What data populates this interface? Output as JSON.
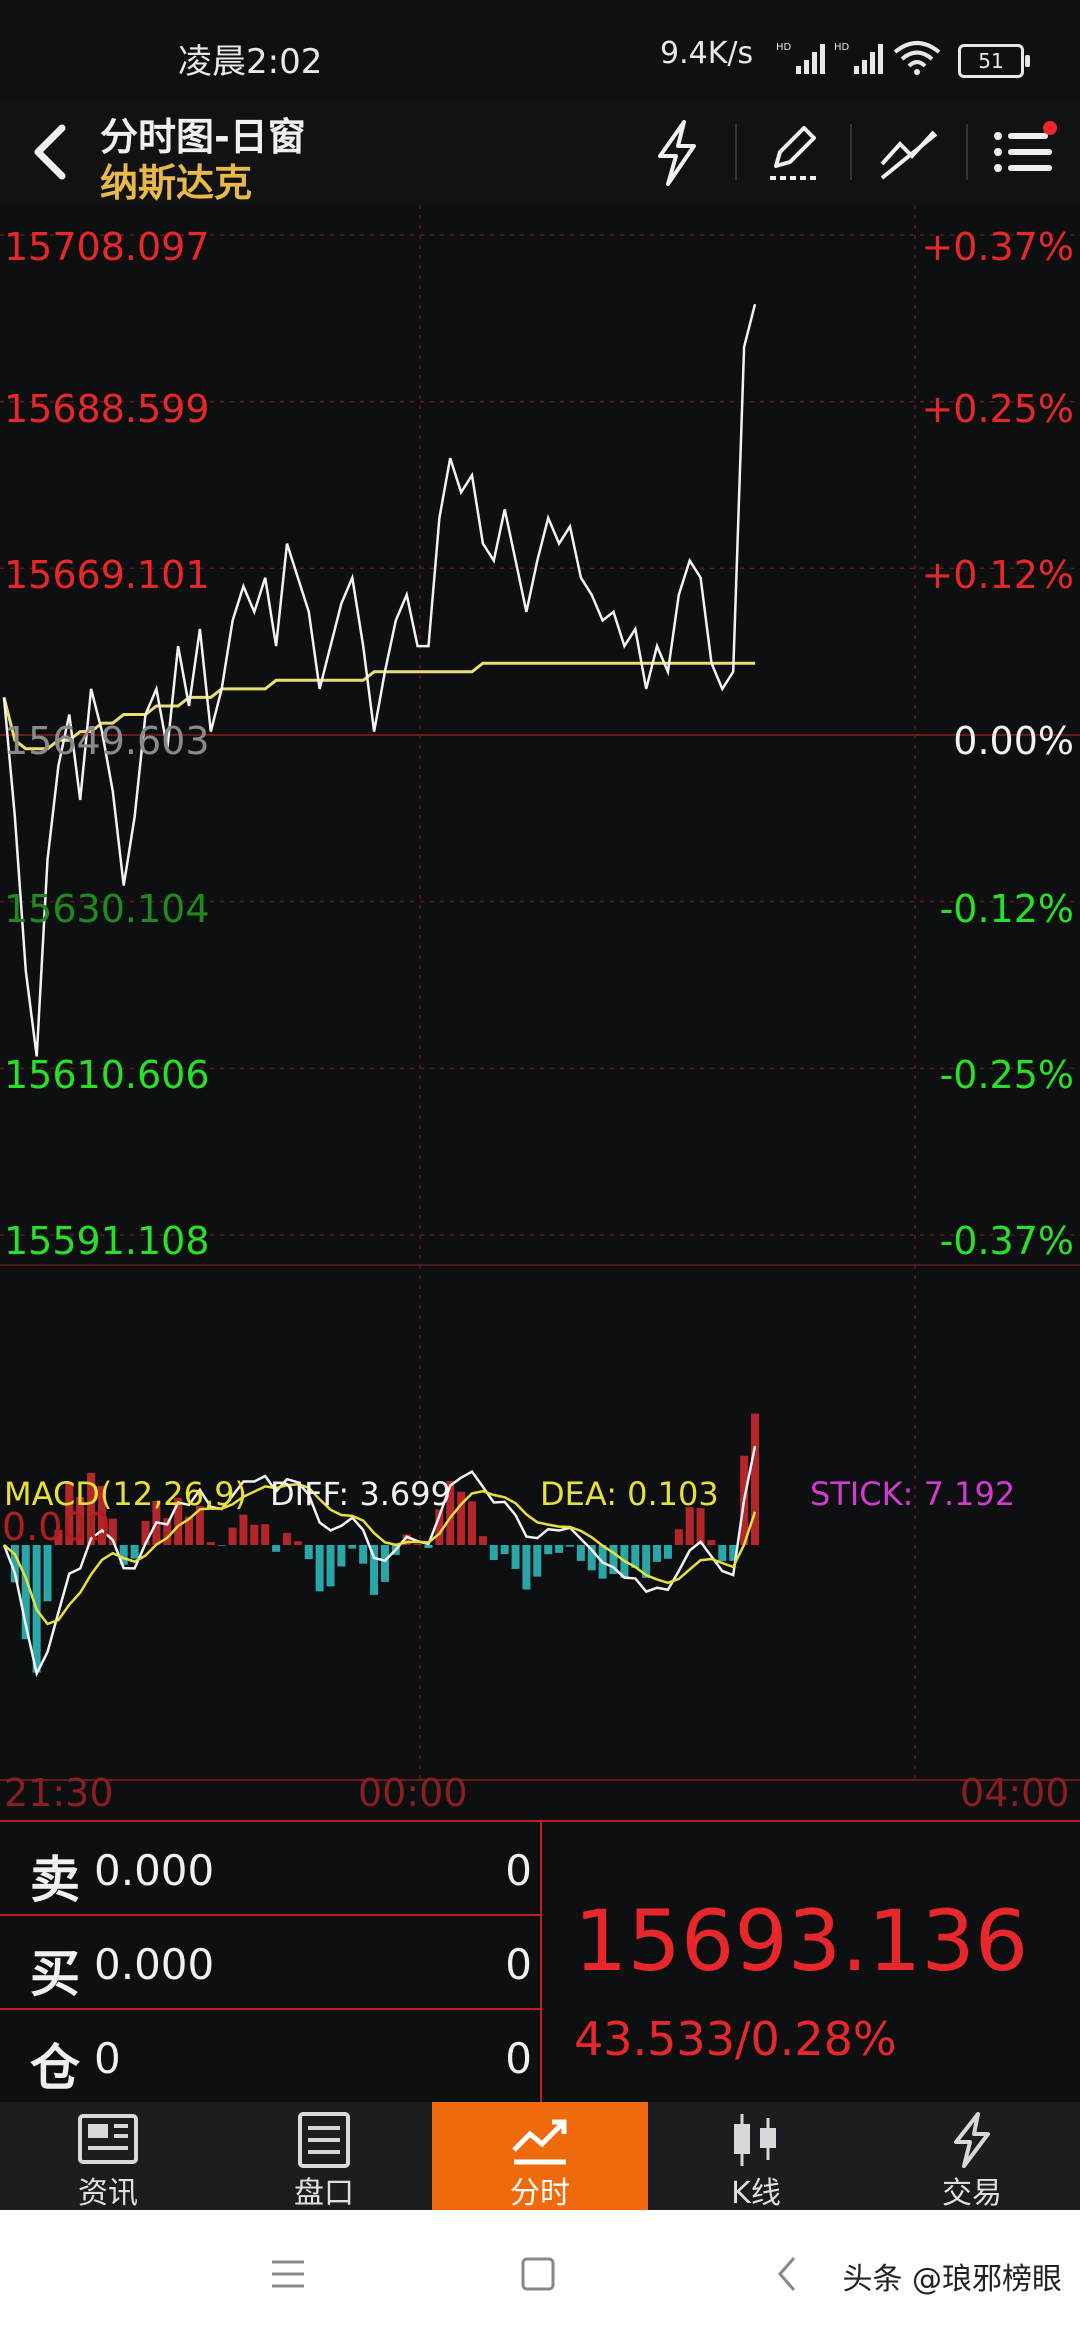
{
  "status_bar": {
    "time": "凌晨2:02",
    "speed": "9.4K/s",
    "battery": "51",
    "icons": [
      "hd-signal-icon",
      "hd-signal-icon",
      "wifi-icon",
      "battery-icon"
    ]
  },
  "header": {
    "title": "分时图-日窗",
    "subtitle": "纳斯达克",
    "icons": [
      "back-icon",
      "lightning-icon",
      "pen-icon",
      "draw-line-icon",
      "menu-icon"
    ]
  },
  "price_axis": {
    "left": [
      "15708.097",
      "15688.599",
      "15669.101",
      "15649.603",
      "15630.104",
      "15610.606",
      "15591.108"
    ],
    "right": [
      "+0.37%",
      "+0.25%",
      "+0.12%",
      "0.00%",
      "-0.12%",
      "-0.25%",
      "-0.37%"
    ]
  },
  "macd": {
    "title": "MACD(12,26,9)",
    "diff": "DIFF: 3.699",
    "dea": "DEA: 0.103",
    "stick": "STICK: 7.192",
    "zero_label": "0.000"
  },
  "time_axis": [
    "21:30",
    "00:00",
    "04:00"
  ],
  "quote": {
    "rows": [
      {
        "tag": "卖",
        "value": "0.000",
        "qty": "0"
      },
      {
        "tag": "买",
        "value": "0.000",
        "qty": "0"
      },
      {
        "tag": "仓",
        "value": "0",
        "qty": "0"
      }
    ],
    "price": "15693.136",
    "change": "43.533/0.28%"
  },
  "nav": [
    {
      "label": "资讯",
      "icon": "news-icon"
    },
    {
      "label": "盘口",
      "icon": "orderbook-icon"
    },
    {
      "label": "分时",
      "icon": "timeshare-icon"
    },
    {
      "label": "K线",
      "icon": "candlestick-icon"
    },
    {
      "label": "交易",
      "icon": "trade-icon"
    }
  ],
  "watermark": "头条 @琅邪榜眼",
  "colors": {
    "up": "#e8272b",
    "down": "#28e028",
    "accent": "#ef6a0d",
    "avg_line": "#e8e070"
  },
  "chart_data": {
    "type": "line",
    "ylim": [
      15591.108,
      15708.097
    ],
    "reference_price": 15649.603,
    "x_ticks": [
      "21:30",
      "00:00",
      "04:00"
    ],
    "series": [
      {
        "values": [
          15654,
          15640,
          15622,
          15612,
          15635,
          15646,
          15652,
          15642,
          15655,
          15650,
          15643,
          15632,
          15640,
          15652,
          15655,
          15648,
          15660,
          15653,
          15662,
          15650,
          15655,
          15663,
          15667,
          15664,
          15668,
          15660,
          15672,
          15668,
          15664,
          15655,
          15660,
          15665,
          15668,
          15660,
          15650,
          15657,
          15663,
          15666,
          15660,
          15660,
          15675,
          15682,
          15678,
          15680,
          15672,
          15670,
          15676,
          15670,
          15664,
          15670,
          15675,
          15672,
          15674,
          15668,
          15666,
          15663,
          15664,
          15660,
          15662,
          15655,
          15660,
          15657,
          15666,
          15670,
          15668,
          15658,
          15655,
          15657,
          15695,
          15700
        ]
      },
      {
        "values": [
          15654,
          15649,
          15648,
          15648,
          15648,
          15649,
          15649,
          15650,
          15650,
          15651,
          15651,
          15652,
          15652,
          15652,
          15653,
          15653,
          15653,
          15654,
          15654,
          15654,
          15655,
          15655,
          15655,
          15655,
          15655,
          15656,
          15656,
          15656,
          15656,
          15656,
          15656,
          15656,
          15656,
          15656,
          15657,
          15657,
          15657,
          15657,
          15657,
          15657,
          15657,
          15657,
          15657,
          15657,
          15658,
          15658,
          15658,
          15658,
          15658,
          15658,
          15658,
          15658,
          15658,
          15658,
          15658,
          15658,
          15658,
          15658,
          15658,
          15658,
          15658,
          15658,
          15658,
          15658,
          15658,
          15658,
          15658,
          15658,
          15658,
          15658
        ]
      }
    ]
  }
}
